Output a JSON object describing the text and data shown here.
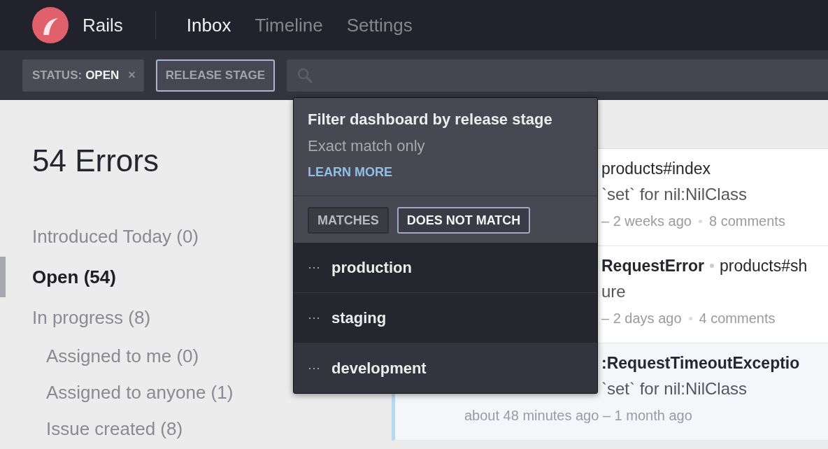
{
  "nav": {
    "brand": "Rails",
    "tabs": [
      {
        "label": "Inbox",
        "selected": true
      },
      {
        "label": "Timeline",
        "selected": false
      },
      {
        "label": "Settings",
        "selected": false
      }
    ]
  },
  "filter_bar": {
    "status_chip": {
      "label": "STATUS:",
      "value": "OPEN",
      "remove": "×"
    },
    "release_stage_button": {
      "label": "RELEASE STAGE",
      "active": true
    }
  },
  "popup": {
    "title": "Filter dashboard by release stage",
    "subtitle": "Exact match only",
    "link": "LEARN MORE",
    "match_buttons": [
      {
        "label": "MATCHES",
        "selected": false
      },
      {
        "label": "DOES NOT MATCH",
        "selected": true
      }
    ],
    "stages": [
      {
        "dots": "···",
        "name": "production",
        "highlighted": true
      },
      {
        "dots": "···",
        "name": "staging",
        "highlighted": true
      },
      {
        "dots": "···",
        "name": "development",
        "highlighted": false
      }
    ]
  },
  "sidebar": {
    "heading": "54 Errors",
    "items": [
      {
        "label": "Introduced Today (0)",
        "selected": false
      },
      {
        "label": "Open (54)",
        "selected": true
      },
      {
        "label": "In progress (8)",
        "selected": false,
        "children": [
          {
            "label": "Assigned to me (0)",
            "selected": false
          },
          {
            "label": "Assigned to anyone (1)",
            "selected": false
          },
          {
            "label": "Issue created (8)",
            "selected": false
          }
        ]
      }
    ]
  },
  "errors": [
    {
      "title": [
        {
          "text": "products#index",
          "bold": false
        }
      ],
      "message": "`set` for nil:NilClass",
      "meta": [
        "– 2 weeks ago",
        "8 comments"
      ],
      "marked": false
    },
    {
      "title": [
        {
          "text": "RequestError",
          "bold": true
        },
        {
          "text": "products#sh",
          "bold": false
        }
      ],
      "message": "ure",
      "meta": [
        "– 2 days ago",
        "4 comments"
      ],
      "marked": false
    },
    {
      "title": [
        {
          "text": ":RequestTimeoutExceptio",
          "bold": true
        }
      ],
      "message": "`set` for nil:NilClass",
      "meta": [
        "about 48 minutes ago – 1 month ago"
      ],
      "marked": true
    }
  ]
}
